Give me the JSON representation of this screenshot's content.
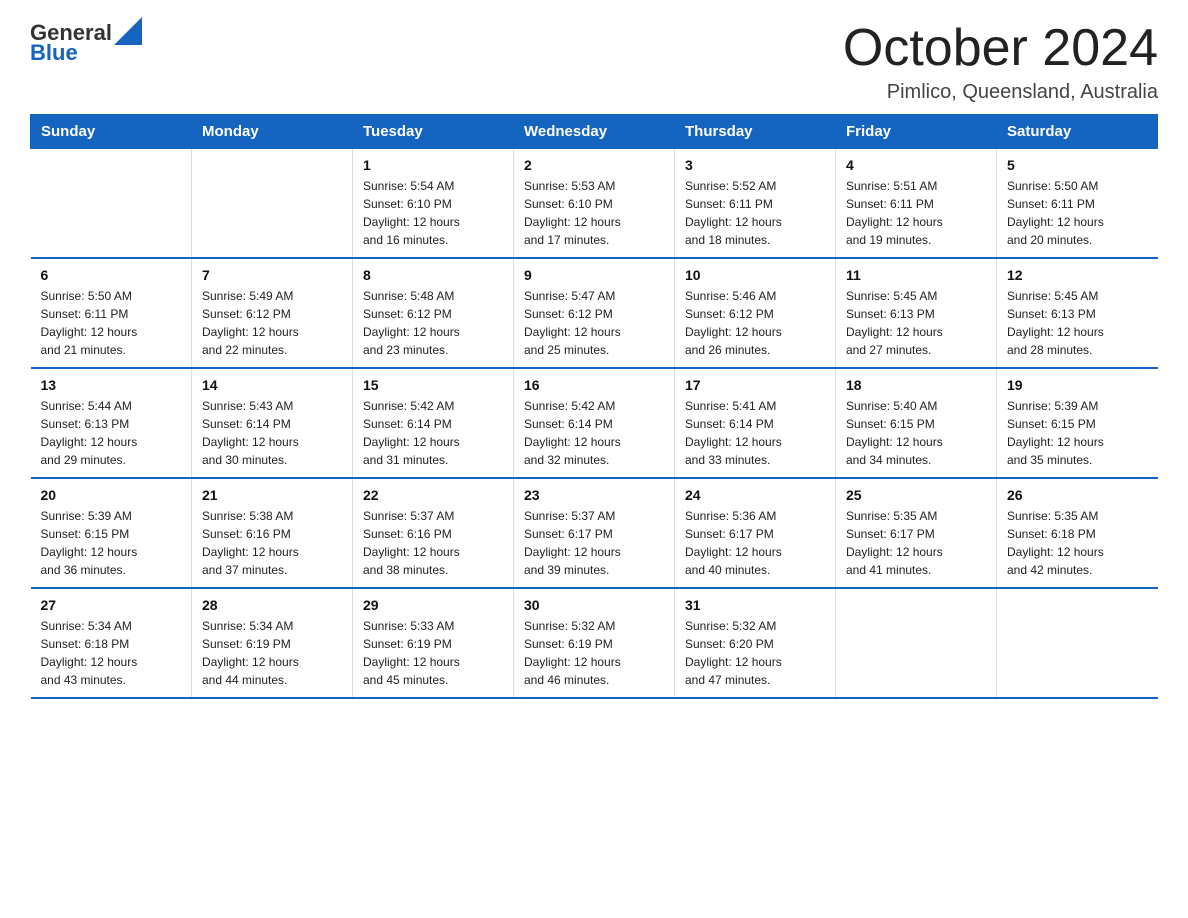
{
  "logo": {
    "text_general": "General",
    "text_blue": "Blue"
  },
  "header": {
    "title": "October 2024",
    "subtitle": "Pimlico, Queensland, Australia"
  },
  "days_of_week": [
    "Sunday",
    "Monday",
    "Tuesday",
    "Wednesday",
    "Thursday",
    "Friday",
    "Saturday"
  ],
  "weeks": [
    [
      {
        "day": "",
        "info": ""
      },
      {
        "day": "",
        "info": ""
      },
      {
        "day": "1",
        "info": "Sunrise: 5:54 AM\nSunset: 6:10 PM\nDaylight: 12 hours\nand 16 minutes."
      },
      {
        "day": "2",
        "info": "Sunrise: 5:53 AM\nSunset: 6:10 PM\nDaylight: 12 hours\nand 17 minutes."
      },
      {
        "day": "3",
        "info": "Sunrise: 5:52 AM\nSunset: 6:11 PM\nDaylight: 12 hours\nand 18 minutes."
      },
      {
        "day": "4",
        "info": "Sunrise: 5:51 AM\nSunset: 6:11 PM\nDaylight: 12 hours\nand 19 minutes."
      },
      {
        "day": "5",
        "info": "Sunrise: 5:50 AM\nSunset: 6:11 PM\nDaylight: 12 hours\nand 20 minutes."
      }
    ],
    [
      {
        "day": "6",
        "info": "Sunrise: 5:50 AM\nSunset: 6:11 PM\nDaylight: 12 hours\nand 21 minutes."
      },
      {
        "day": "7",
        "info": "Sunrise: 5:49 AM\nSunset: 6:12 PM\nDaylight: 12 hours\nand 22 minutes."
      },
      {
        "day": "8",
        "info": "Sunrise: 5:48 AM\nSunset: 6:12 PM\nDaylight: 12 hours\nand 23 minutes."
      },
      {
        "day": "9",
        "info": "Sunrise: 5:47 AM\nSunset: 6:12 PM\nDaylight: 12 hours\nand 25 minutes."
      },
      {
        "day": "10",
        "info": "Sunrise: 5:46 AM\nSunset: 6:12 PM\nDaylight: 12 hours\nand 26 minutes."
      },
      {
        "day": "11",
        "info": "Sunrise: 5:45 AM\nSunset: 6:13 PM\nDaylight: 12 hours\nand 27 minutes."
      },
      {
        "day": "12",
        "info": "Sunrise: 5:45 AM\nSunset: 6:13 PM\nDaylight: 12 hours\nand 28 minutes."
      }
    ],
    [
      {
        "day": "13",
        "info": "Sunrise: 5:44 AM\nSunset: 6:13 PM\nDaylight: 12 hours\nand 29 minutes."
      },
      {
        "day": "14",
        "info": "Sunrise: 5:43 AM\nSunset: 6:14 PM\nDaylight: 12 hours\nand 30 minutes."
      },
      {
        "day": "15",
        "info": "Sunrise: 5:42 AM\nSunset: 6:14 PM\nDaylight: 12 hours\nand 31 minutes."
      },
      {
        "day": "16",
        "info": "Sunrise: 5:42 AM\nSunset: 6:14 PM\nDaylight: 12 hours\nand 32 minutes."
      },
      {
        "day": "17",
        "info": "Sunrise: 5:41 AM\nSunset: 6:14 PM\nDaylight: 12 hours\nand 33 minutes."
      },
      {
        "day": "18",
        "info": "Sunrise: 5:40 AM\nSunset: 6:15 PM\nDaylight: 12 hours\nand 34 minutes."
      },
      {
        "day": "19",
        "info": "Sunrise: 5:39 AM\nSunset: 6:15 PM\nDaylight: 12 hours\nand 35 minutes."
      }
    ],
    [
      {
        "day": "20",
        "info": "Sunrise: 5:39 AM\nSunset: 6:15 PM\nDaylight: 12 hours\nand 36 minutes."
      },
      {
        "day": "21",
        "info": "Sunrise: 5:38 AM\nSunset: 6:16 PM\nDaylight: 12 hours\nand 37 minutes."
      },
      {
        "day": "22",
        "info": "Sunrise: 5:37 AM\nSunset: 6:16 PM\nDaylight: 12 hours\nand 38 minutes."
      },
      {
        "day": "23",
        "info": "Sunrise: 5:37 AM\nSunset: 6:17 PM\nDaylight: 12 hours\nand 39 minutes."
      },
      {
        "day": "24",
        "info": "Sunrise: 5:36 AM\nSunset: 6:17 PM\nDaylight: 12 hours\nand 40 minutes."
      },
      {
        "day": "25",
        "info": "Sunrise: 5:35 AM\nSunset: 6:17 PM\nDaylight: 12 hours\nand 41 minutes."
      },
      {
        "day": "26",
        "info": "Sunrise: 5:35 AM\nSunset: 6:18 PM\nDaylight: 12 hours\nand 42 minutes."
      }
    ],
    [
      {
        "day": "27",
        "info": "Sunrise: 5:34 AM\nSunset: 6:18 PM\nDaylight: 12 hours\nand 43 minutes."
      },
      {
        "day": "28",
        "info": "Sunrise: 5:34 AM\nSunset: 6:19 PM\nDaylight: 12 hours\nand 44 minutes."
      },
      {
        "day": "29",
        "info": "Sunrise: 5:33 AM\nSunset: 6:19 PM\nDaylight: 12 hours\nand 45 minutes."
      },
      {
        "day": "30",
        "info": "Sunrise: 5:32 AM\nSunset: 6:19 PM\nDaylight: 12 hours\nand 46 minutes."
      },
      {
        "day": "31",
        "info": "Sunrise: 5:32 AM\nSunset: 6:20 PM\nDaylight: 12 hours\nand 47 minutes."
      },
      {
        "day": "",
        "info": ""
      },
      {
        "day": "",
        "info": ""
      }
    ]
  ],
  "colors": {
    "header_bg": "#1565c0",
    "header_text": "#ffffff",
    "border": "#1565c0",
    "text": "#222222"
  }
}
